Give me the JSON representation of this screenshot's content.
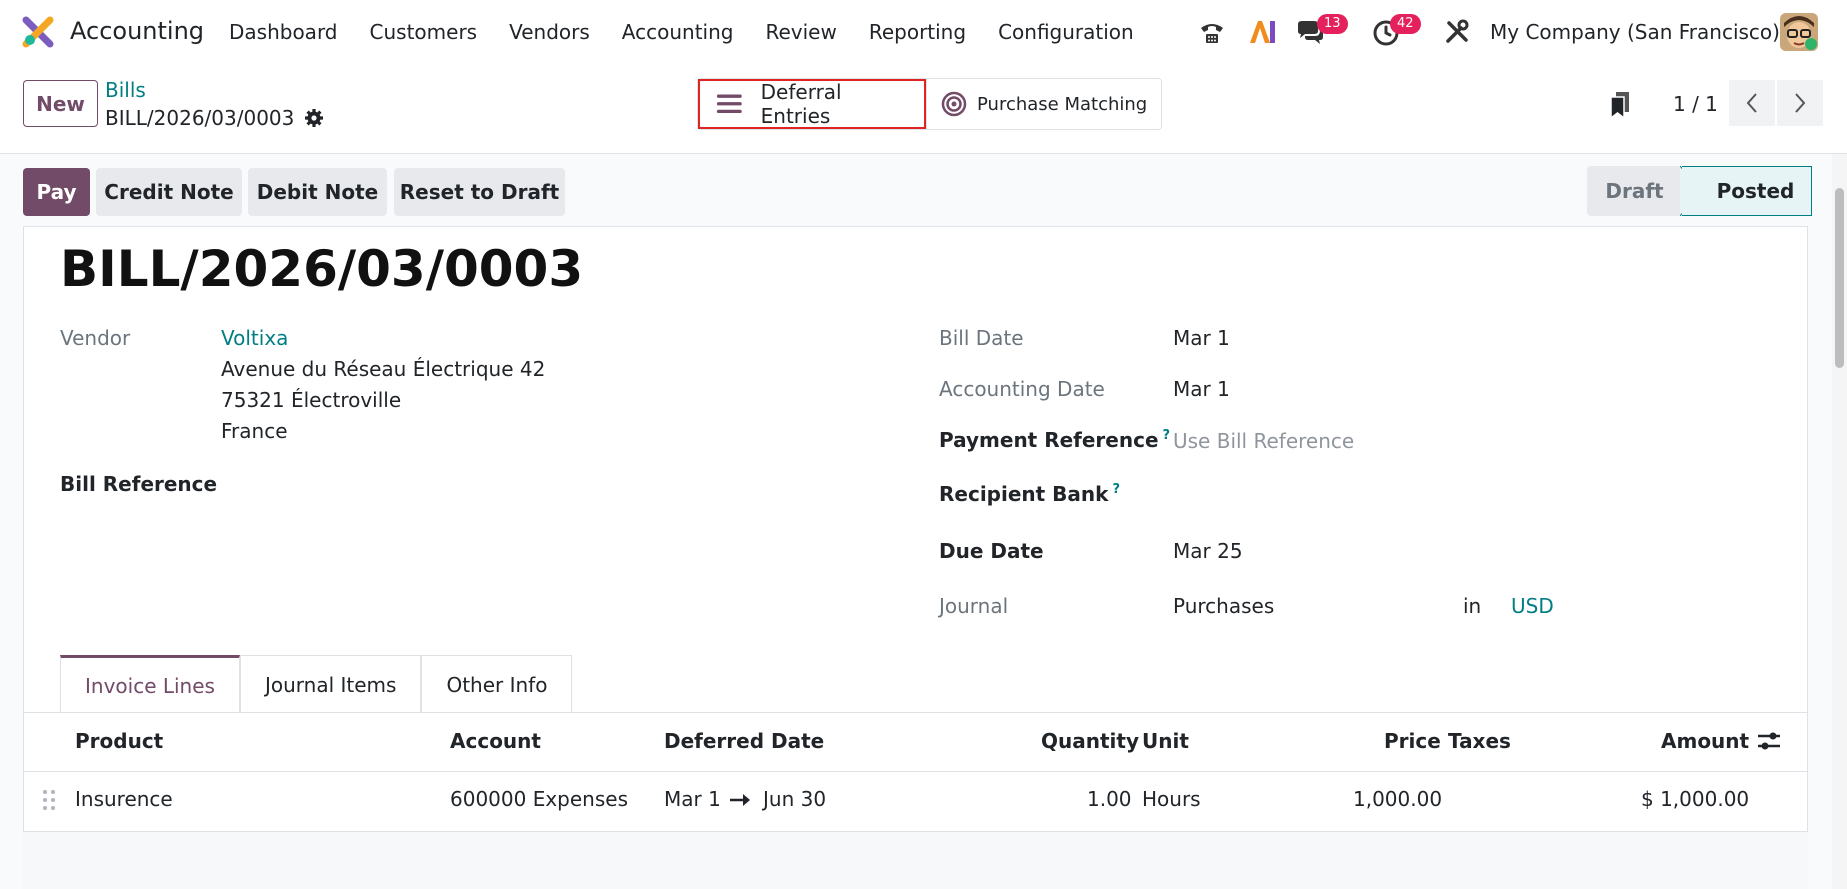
{
  "app": {
    "name": "Accounting"
  },
  "menu": [
    "Dashboard",
    "Customers",
    "Vendors",
    "Accounting",
    "Review",
    "Reporting",
    "Configuration"
  ],
  "systray": {
    "messages_count": "13",
    "activities_count": "42",
    "company": "My Company (San Francisco)"
  },
  "control": {
    "new_label": "New",
    "breadcrumb_parent": "Bills",
    "breadcrumb_current": "BILL/2026/03/0003",
    "smart_deferral": "Deferral Entries",
    "smart_purchase": "Purchase Matching",
    "pager": "1 / 1"
  },
  "actions": {
    "pay": "Pay",
    "credit_note": "Credit Note",
    "debit_note": "Debit Note",
    "reset": "Reset to Draft"
  },
  "status": {
    "draft": "Draft",
    "posted": "Posted"
  },
  "record": {
    "title": "BILL/2026/03/0003",
    "vendor_label": "Vendor",
    "vendor_name": "Voltixa",
    "vendor_address": [
      "Avenue du Réseau Électrique 42",
      "75321 Électroville",
      "France"
    ],
    "bill_reference_label": "Bill Reference",
    "bill_date_label": "Bill Date",
    "bill_date": "Mar 1",
    "accounting_date_label": "Accounting Date",
    "accounting_date": "Mar 1",
    "payment_reference_label": "Payment Reference",
    "payment_reference_placeholder": "Use Bill Reference",
    "recipient_bank_label": "Recipient Bank",
    "due_date_label": "Due Date",
    "due_date": "Mar 25",
    "journal_label": "Journal",
    "journal": "Purchases",
    "journal_in": "in",
    "currency": "USD",
    "help_mark": "?"
  },
  "tabs": [
    "Invoice Lines",
    "Journal Items",
    "Other Info"
  ],
  "table": {
    "headers": {
      "product": "Product",
      "account": "Account",
      "deferred_date": "Deferred Date",
      "quantity": "Quantity",
      "unit": "Unit",
      "price": "Price",
      "taxes": "Taxes",
      "amount": "Amount"
    },
    "rows": [
      {
        "product": "Insurence",
        "account": "600000 Expenses",
        "deferred_start": "Mar 1",
        "deferred_end": "Jun 30",
        "quantity": "1.00",
        "unit": "Hours",
        "price": "1,000.00",
        "amount": "$ 1,000.00"
      }
    ]
  },
  "colors": {
    "brand": "#714b67",
    "link": "#017e84",
    "badge": "#e4215c",
    "highlight": "#e02424"
  }
}
